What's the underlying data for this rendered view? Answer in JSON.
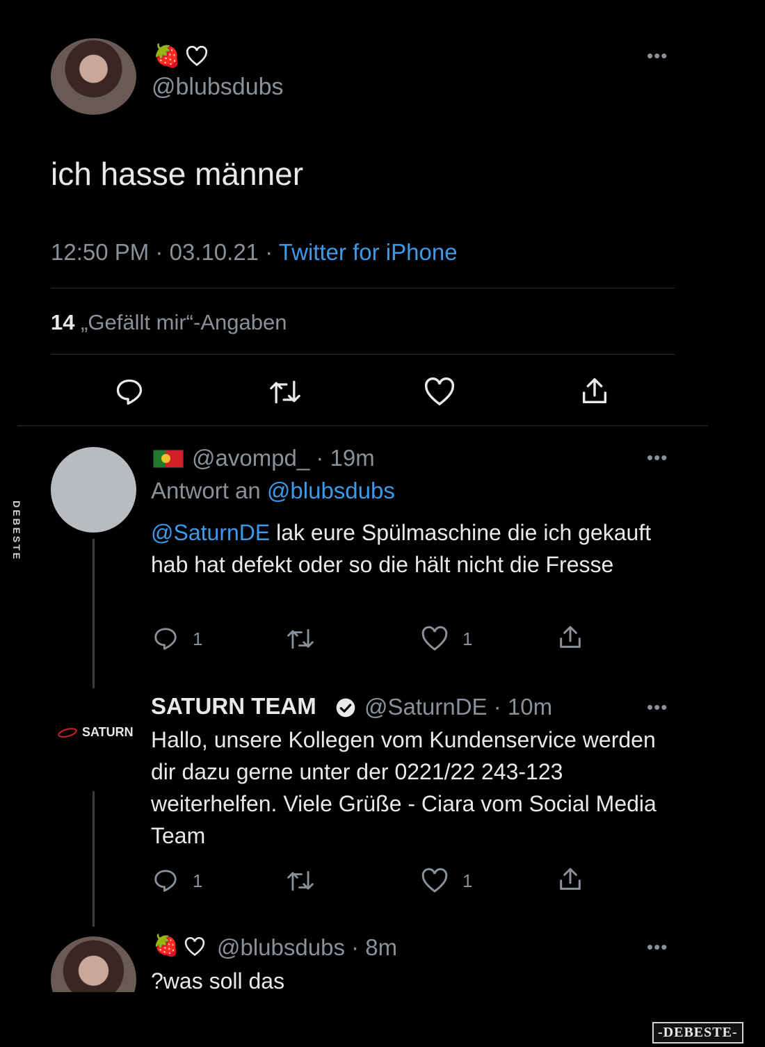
{
  "main_tweet": {
    "handle": "@blubsdubs",
    "text": "ich hasse männer",
    "time": "12:50 PM · 03.10.21 ·",
    "client": "Twitter for iPhone",
    "likes_count": "14",
    "likes_label": "„Gefällt mir“-Angaben"
  },
  "replies": [
    {
      "handle_meta": "@avompd_ · 19m",
      "reply_to_prefix": "Antwort an",
      "reply_to_handle": "@blubsdubs",
      "mention": "@SaturnDE",
      "text": " lak eure Spülmaschine die ich gekauft hab hat defekt oder so die hält nicht die Fresse",
      "reply_count": "1",
      "like_count": "1"
    },
    {
      "name": "SATURN TEAM",
      "handle_meta": "@SaturnDE · 10m",
      "logo_text": "SATURN",
      "text": "Hallo, unsere Kollegen vom Kundenservice werden dir dazu gerne unter der 0221/22 243-123 weiterhelfen. Viele Grüße - Ciara vom Social Media Team",
      "reply_count": "1",
      "like_count": "1"
    },
    {
      "handle_meta": "@blubsdubs · 8m",
      "text": "?was soll das"
    }
  ],
  "watermark": {
    "side": "DEBESTE",
    "corner": "-DEBESTE-"
  },
  "colors": {
    "background": "#000000",
    "text": "#e7e9ea",
    "muted": "#8b9198",
    "link": "#3d9ae8"
  }
}
